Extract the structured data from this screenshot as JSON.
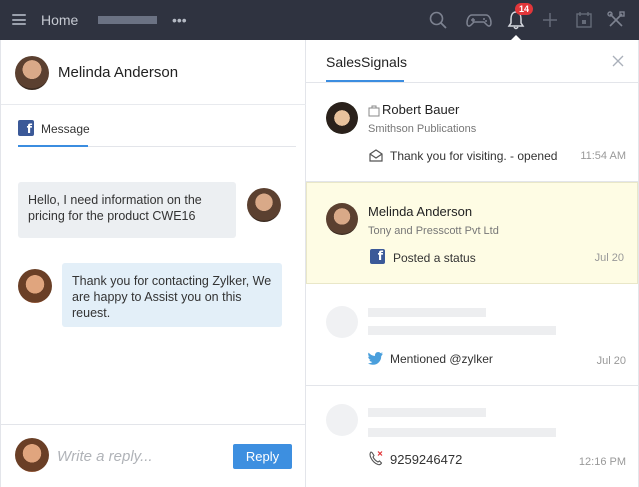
{
  "topbar": {
    "home_label": "Home",
    "icons": [
      "menu-icon",
      "more-icon",
      "search-icon",
      "gamepad-icon",
      "bell-icon",
      "plus-icon",
      "calendar-icon",
      "tools-icon"
    ],
    "notification_count": "14",
    "colors": {
      "background": "#2f3340",
      "badge": "#e2363a"
    }
  },
  "left_panel": {
    "contact_name": "Melinda Anderson",
    "tab_label": "Message",
    "messages": [
      {
        "text": "Hello, I need information on the pricing for the product CWE16",
        "direction": "incoming"
      },
      {
        "text": "Thank you for contacting Zylker, We are  happy to Assist you on this reuest.",
        "direction": "outgoing"
      }
    ],
    "reply": {
      "placeholder": "Write a reply...",
      "button_label": "Reply"
    }
  },
  "right_panel": {
    "title": "SalesSignals",
    "signals": [
      {
        "name": "Robert Bauer",
        "company": "Smithson Publications",
        "activity": "Thank you for visiting. - opened",
        "time": "11:54 AM",
        "icon": "email-open-icon",
        "name_icon": "briefcase-icon"
      },
      {
        "name": "Melinda Anderson",
        "company": "Tony and Presscott Pvt Ltd",
        "activity": "Posted a status",
        "time": "Jul 20",
        "icon": "facebook-icon",
        "highlighted": true
      },
      {
        "activity": "Mentioned @zylker",
        "time": "Jul 20",
        "icon": "twitter-icon"
      },
      {
        "activity": "9259246472",
        "time": "12:16 PM",
        "icon": "missed-call-icon"
      }
    ]
  },
  "colors": {
    "accent": "#3d8fe0",
    "highlight": "#fefce4"
  }
}
